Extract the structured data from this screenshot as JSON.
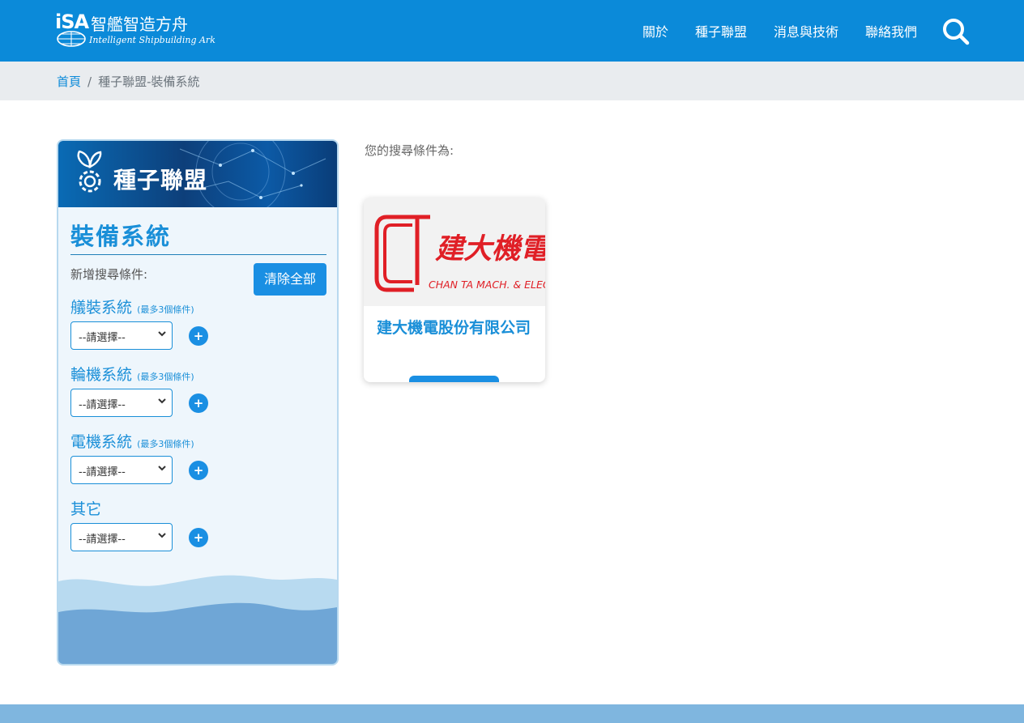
{
  "header": {
    "logo_mark": "iSA",
    "logo_cn": "智艦智造方舟",
    "logo_en": "Intelligent Shipbuilding Ark",
    "nav": [
      "關於",
      "種子聯盟",
      "消息與技術",
      "聯絡我們"
    ],
    "search_icon": "search-icon",
    "bg_color": "#0b8ad9"
  },
  "breadcrumb": {
    "home": "首頁",
    "separator": "/",
    "current": "種子聯盟-裝備系統"
  },
  "sidebar": {
    "banner_title": "種子聯盟",
    "heading": "裝備系統",
    "add_condition_label": "新增搜尋條件:",
    "clear_button": "清除全部",
    "groups": [
      {
        "title": "艤裝系統",
        "note": "(最多3個條件)",
        "select_value": "--請選擇--"
      },
      {
        "title": "輪機系統",
        "note": "(最多3個條件)",
        "select_value": "--請選擇--"
      },
      {
        "title": "電機系統",
        "note": "(最多3個條件)",
        "select_value": "--請選擇--"
      },
      {
        "title": "其它",
        "note": "",
        "select_value": "--請選擇--"
      }
    ],
    "plus_label": "+"
  },
  "main": {
    "criteria_label": "您的搜尋條件為:",
    "cards": [
      {
        "logo_cn": "建大機電",
        "logo_en": "CHAN TA MACH. & ELEC.",
        "title": "建大機電股份有限公司"
      }
    ]
  },
  "colors": {
    "accent": "#1a8fe3",
    "brand": "#0b8ad9",
    "logo_red": "#e01f26"
  }
}
